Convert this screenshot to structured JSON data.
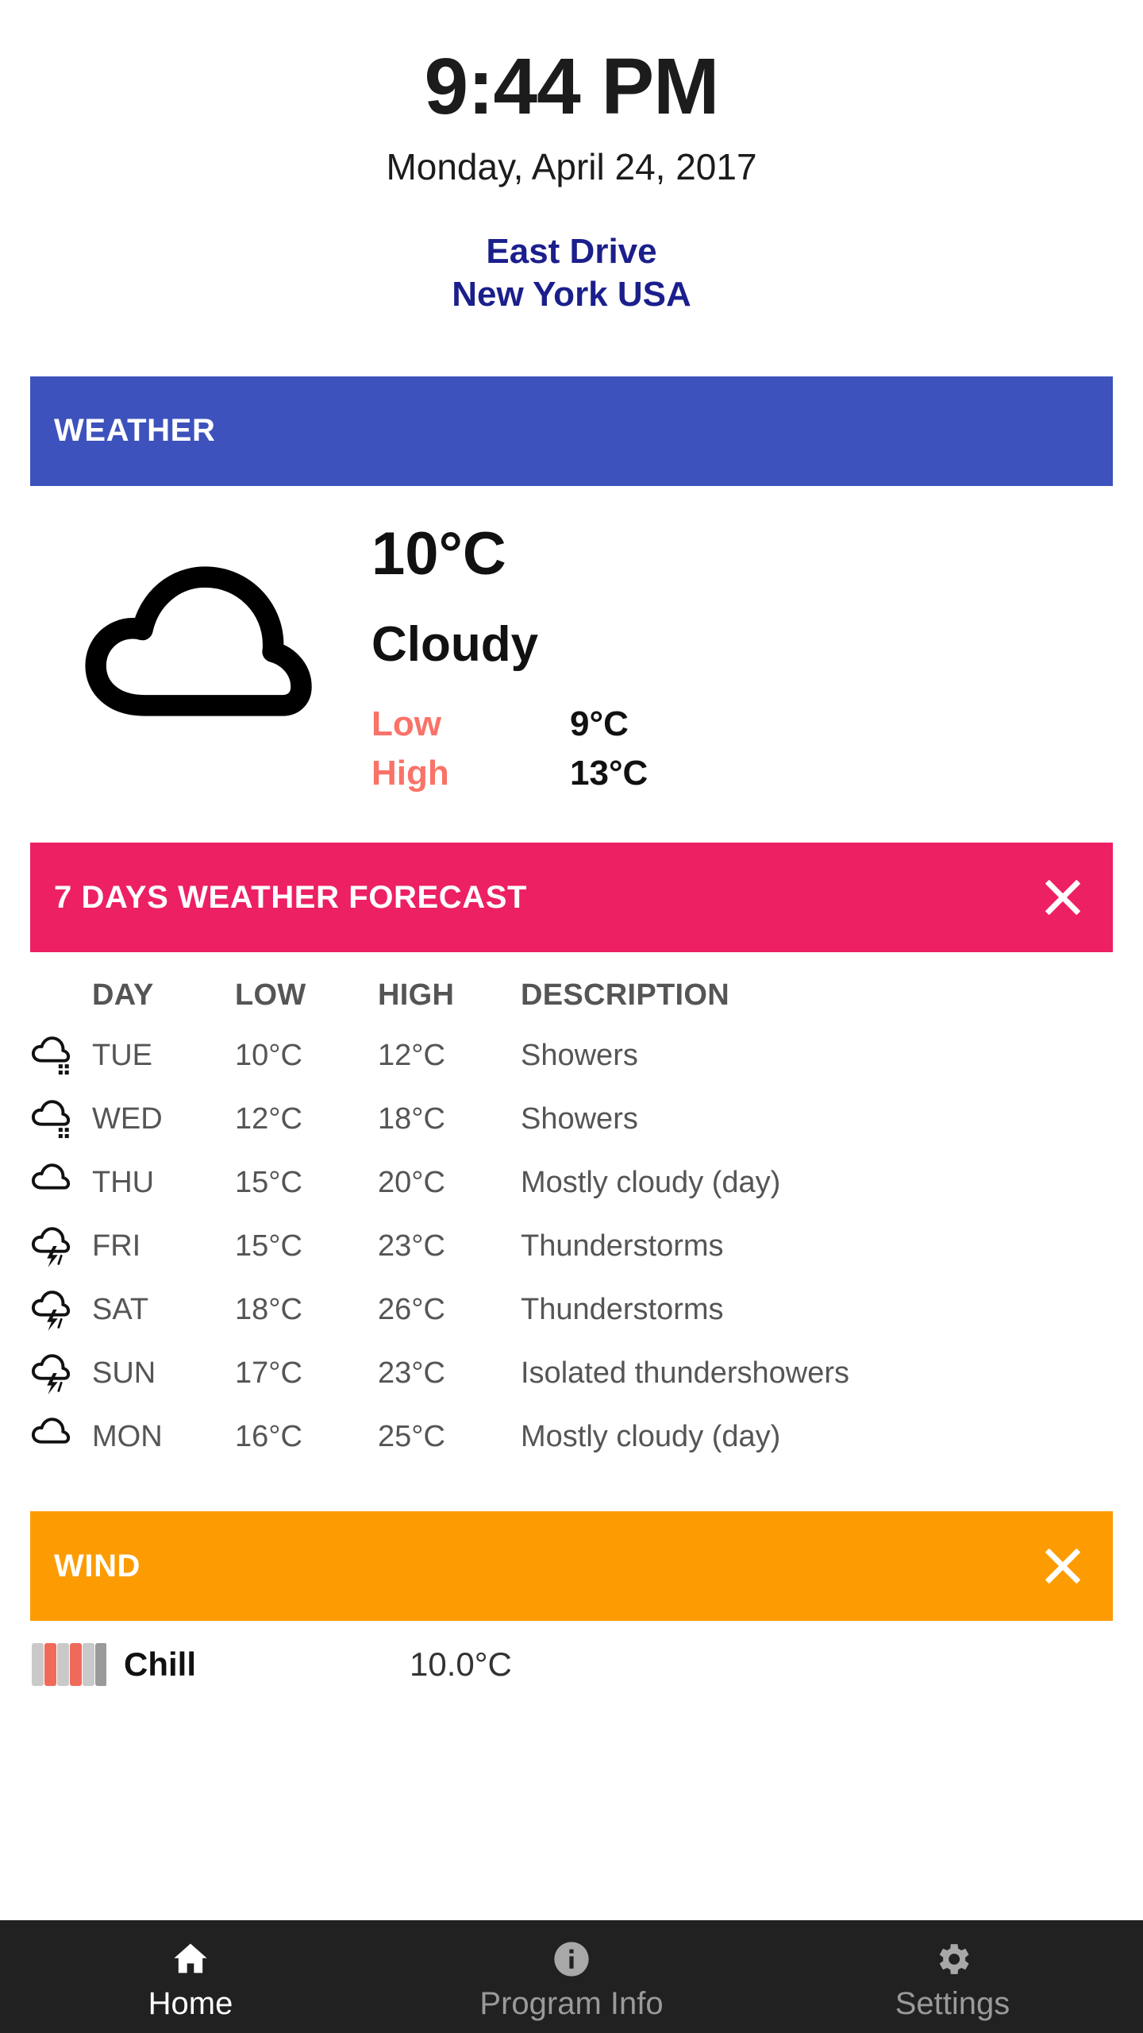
{
  "header": {
    "time": "9:44 PM",
    "date": "Monday, April 24, 2017",
    "location_line1": "East Drive",
    "location_line2": "New York USA"
  },
  "weather_section": {
    "title": "WEATHER",
    "bar_color": "#3d52bc",
    "icon": "cloud-icon",
    "temperature": "10°C",
    "description": "Cloudy",
    "low_label": "Low",
    "low_value": "9°C",
    "high_label": "High",
    "high_value": "13°C",
    "accent_color": "#fa7268"
  },
  "forecast_section": {
    "title": "7 DAYS WEATHER FORECAST",
    "bar_color": "#ed2064",
    "close_icon": "close-icon",
    "columns": [
      "DAY",
      "LOW",
      "HIGH",
      "DESCRIPTION"
    ],
    "rows": [
      {
        "icon": "cloud-showers-icon",
        "day": "TUE",
        "low": "10°C",
        "high": "12°C",
        "description": "Showers"
      },
      {
        "icon": "cloud-showers-icon",
        "day": "WED",
        "low": "12°C",
        "high": "18°C",
        "description": "Showers"
      },
      {
        "icon": "cloud-icon",
        "day": "THU",
        "low": "15°C",
        "high": "20°C",
        "description": "Mostly cloudy (day)"
      },
      {
        "icon": "cloud-lightning-icon",
        "day": "FRI",
        "low": "15°C",
        "high": "23°C",
        "description": "Thunderstorms"
      },
      {
        "icon": "cloud-lightning-icon",
        "day": "SAT",
        "low": "18°C",
        "high": "26°C",
        "description": "Thunderstorms"
      },
      {
        "icon": "cloud-lightning-icon",
        "day": "SUN",
        "low": "17°C",
        "high": "23°C",
        "description": "Isolated thundershowers"
      },
      {
        "icon": "cloud-icon",
        "day": "MON",
        "low": "16°C",
        "high": "25°C",
        "description": "Mostly cloudy (day)"
      }
    ]
  },
  "wind_section": {
    "title": "WIND",
    "bar_color": "#fc9c02",
    "close_icon": "close-icon",
    "rows": [
      {
        "icon": "thermometer-icon",
        "label": "Chill",
        "value": "10.0°C"
      }
    ]
  },
  "bottom_nav": {
    "items": [
      {
        "icon": "home-icon",
        "label": "Home",
        "active": true
      },
      {
        "icon": "info-icon",
        "label": "Program Info",
        "active": false
      },
      {
        "icon": "gear-icon",
        "label": "Settings",
        "active": false
      }
    ]
  }
}
